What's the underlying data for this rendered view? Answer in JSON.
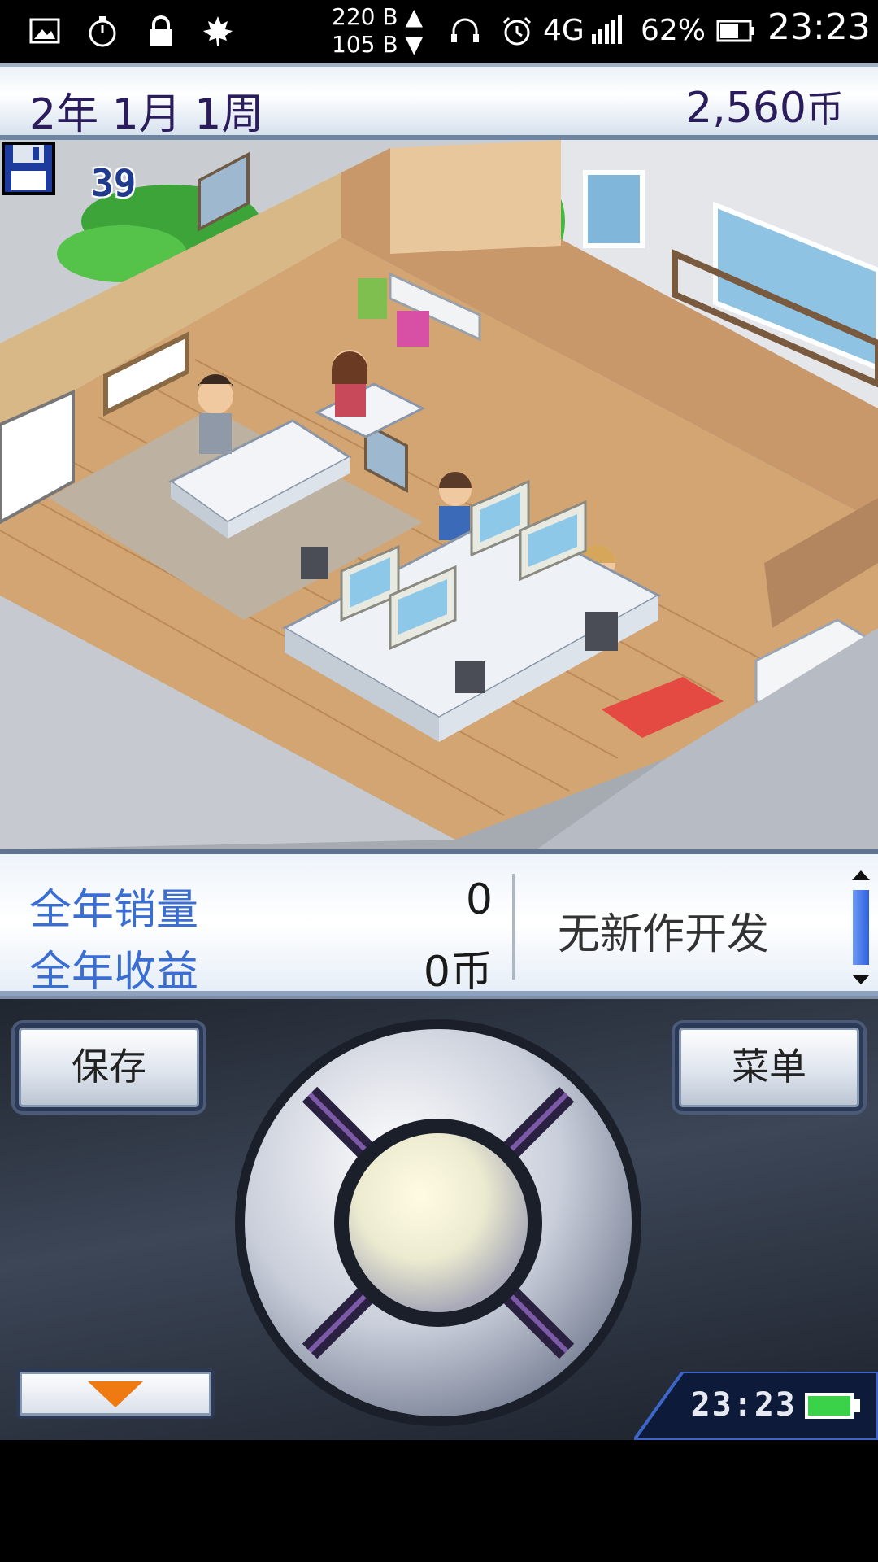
{
  "status_bar": {
    "net_up": "220 B ▲",
    "net_down": "105 B ▼",
    "network": "4G",
    "battery": "62%",
    "time": "23:23",
    "icons": [
      "image-icon",
      "stopwatch-icon",
      "lock-icon",
      "maple-leaf-icon",
      "headset-icon",
      "alarm-icon",
      "signal-icon",
      "battery-icon"
    ]
  },
  "header": {
    "date": "2年 1月 1周",
    "money": "2,560",
    "money_unit": "币"
  },
  "scene": {
    "save_counter": "39",
    "icons": [
      "floppy-disk-icon"
    ]
  },
  "stats": {
    "annual_sales_label": "全年销量",
    "annual_sales_value": "0",
    "annual_revenue_label": "全年收益",
    "annual_revenue_value": "0币",
    "news": "无新作开发"
  },
  "controls": {
    "save_label": "保存",
    "menu_label": "菜单",
    "clock": "23:23"
  },
  "colors": {
    "accent_text": "#2b1d5b",
    "label_blue": "#3b6ed3",
    "arrow_orange": "#f07a12",
    "battery_green": "#3bd24a"
  }
}
